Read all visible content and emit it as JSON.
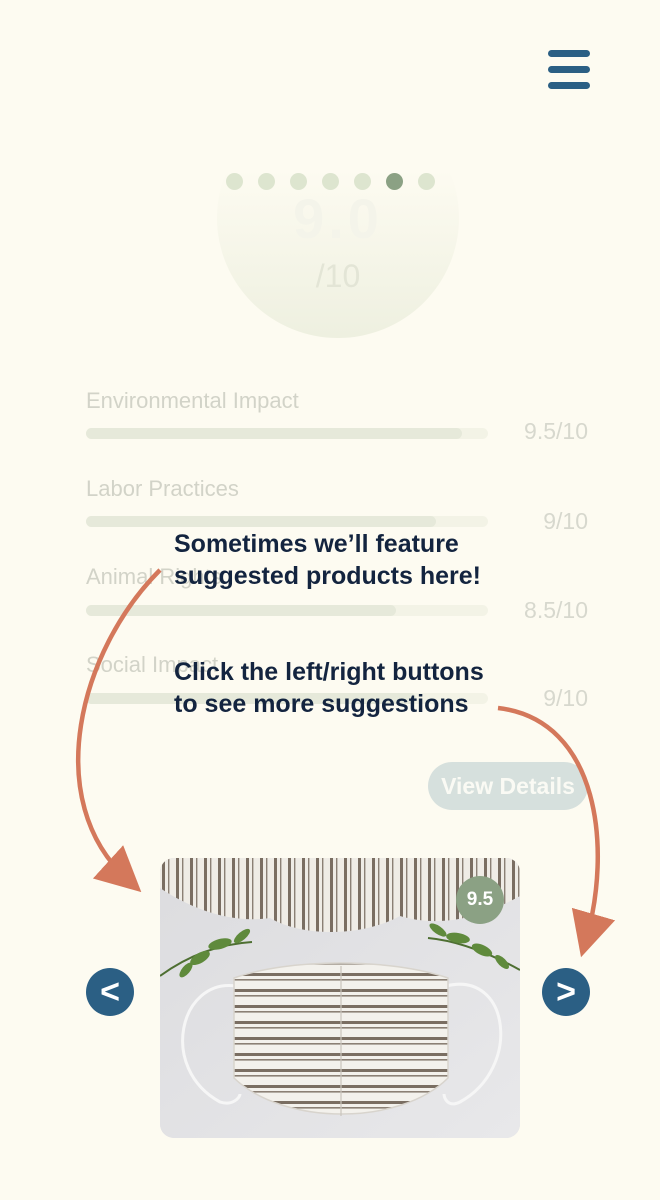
{
  "header": {
    "menu_icon": "hamburger-menu-icon"
  },
  "score": {
    "value": "9.0",
    "denominator": "/10"
  },
  "carousel_dots": {
    "count": 7,
    "active_index": 5
  },
  "metrics": [
    {
      "label": "Environmental Impact",
      "score": "9.5/10",
      "fraction": 0.935
    },
    {
      "label": "Labor Practices",
      "score": "9/10",
      "fraction": 0.87
    },
    {
      "label": "Animal Rights",
      "score": "8.5/10",
      "fraction": 0.77
    },
    {
      "label": "Social Impact",
      "score": "9/10",
      "fraction": 0.82
    }
  ],
  "view_details_label": "View Details",
  "callouts": {
    "featured_line1": "Sometimes we’ll feature",
    "featured_line2": "suggested products here!",
    "nav_line1": "Click the left/right buttons",
    "nav_line2": "to see more suggestions"
  },
  "product": {
    "score_badge": "9.5",
    "image_subject": "striped-face-mask"
  },
  "nav": {
    "prev_label": "<",
    "next_label": ">"
  },
  "colors": {
    "background": "#fdfbf1",
    "primary": "#2b5f84",
    "accent_green": "#8ba184",
    "annotation_arrow": "#d4785b",
    "callout_text": "#13243f"
  }
}
